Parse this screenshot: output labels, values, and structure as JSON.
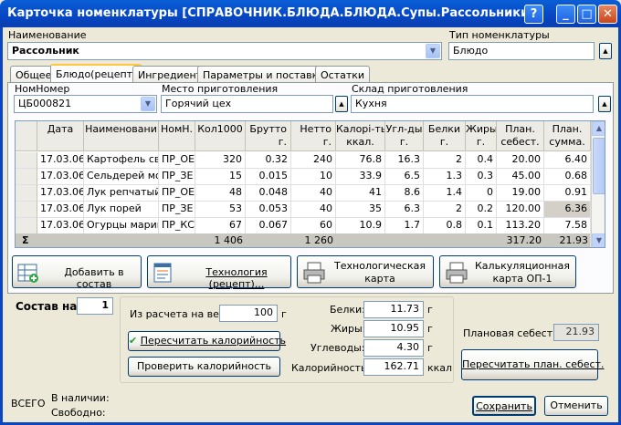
{
  "window": {
    "title": "Карточка номенклатуры [СПРАВОЧНИК.БЛЮДА.БЛЮДА.Супы.Рассольники]",
    "help": "?",
    "minimize": "_",
    "maximize": "□",
    "close": "✕"
  },
  "name": {
    "label": "Наименование",
    "value": "Рассольник"
  },
  "type": {
    "label": "Тип номенклатуры",
    "value": "Блюдо"
  },
  "tabs": [
    "Общее",
    "Блюдо(рецепт)",
    "Ингредиент",
    "Параметры и поставки",
    "Остатки"
  ],
  "nomnomer": {
    "label": "НомНомер",
    "value": "ЦБ000821"
  },
  "place": {
    "label": "Место приготовления",
    "value": "Горячий цех"
  },
  "warehouse": {
    "label": "Склад приготовления",
    "value": "Кухня"
  },
  "table": {
    "headers": [
      [
        "Дата",
        ""
      ],
      [
        "Наименовани",
        ""
      ],
      [
        "НомН.",
        ""
      ],
      [
        "Кол1000",
        ""
      ],
      [
        "Брутто",
        "г."
      ],
      [
        "Нетто",
        "г."
      ],
      [
        "Калорі-ть",
        "ккал."
      ],
      [
        "Угл-ды",
        "г."
      ],
      [
        "Белки",
        "г."
      ],
      [
        "Жиры",
        "г."
      ],
      [
        "План.",
        "себест."
      ],
      [
        "План.",
        "сумма."
      ]
    ],
    "rows": [
      [
        "17.03.06",
        "Картофель све",
        "ПР_ОЕ",
        "320",
        "0.32",
        "240",
        "76.8",
        "16.3",
        "2",
        "0.4",
        "20.00",
        "6.40"
      ],
      [
        "17.03.06",
        "Сельдерей мол",
        "ПР_ЗЕ",
        "15",
        "0.015",
        "10",
        "33.9",
        "6.5",
        "1.3",
        "0.3",
        "45.00",
        "0.68"
      ],
      [
        "17.03.06",
        "Лук репчатый",
        "ПР_ОЕ",
        "48",
        "0.048",
        "40",
        "41",
        "8.6",
        "1.4",
        "0",
        "19.00",
        "0.91"
      ],
      [
        "17.03.06",
        "Лук порей",
        "ПР_ЗЕ",
        "53",
        "0.053",
        "40",
        "35",
        "6.3",
        "2",
        "0.2",
        "120.00",
        "6.36"
      ],
      [
        "17.03.06",
        "Огурцы марин",
        "ПР_КС",
        "67",
        "0.067",
        "60",
        "10.9",
        "1.7",
        "0.8",
        "0.1",
        "113.20",
        "7.58"
      ]
    ],
    "sigma": "Σ",
    "totals": {
      "kol": "1 406",
      "netto": "1 260",
      "sebest": "317.20",
      "summa": "21.93"
    }
  },
  "buttons": {
    "add": "Добавить в состав",
    "tech": "Технология (рецепт)...",
    "card_line1": "Технологическая",
    "card_line2": "карта",
    "calc_line1": "Калькуляционная",
    "calc_line2": "карта ОП-1",
    "recalc_cal": "Пересчитать калорийность",
    "check_cal": "Проверить калорийность",
    "recalc_cost": "Пересчитать план. себест.",
    "save": "Сохранить",
    "cancel": "Отменить"
  },
  "sostav": {
    "label": "Состав на",
    "value": "1"
  },
  "weight": {
    "label": "Из расчета на вес:",
    "value": "100",
    "unit": "г"
  },
  "nutrition": {
    "proteins_label": "Белки:",
    "proteins": "11.73",
    "proteins_unit": "г",
    "fats_label": "Жиры:",
    "fats": "10.95",
    "fats_unit": "г",
    "carbs_label": "Углеводы:",
    "carbs": "4.30",
    "carbs_unit": "г",
    "cal_label": "Калорийность:",
    "cal": "162.71",
    "cal_unit": "ккал"
  },
  "planned_cost": {
    "label": "Плановая себест.",
    "value": "21.93"
  },
  "footer": {
    "total": "ВСЕГО",
    "available": "В наличии:",
    "free": "Свободно:"
  }
}
